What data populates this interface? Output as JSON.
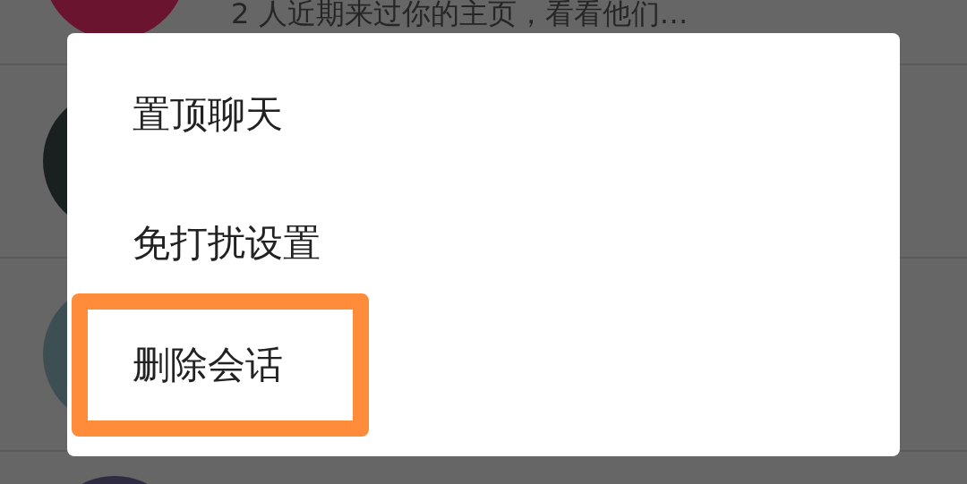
{
  "chat_list": {
    "rows": [
      {
        "kind": "picture",
        "color": "#6a1430",
        "preview": "2 人近期来过你的主页，看看他们…"
      },
      {
        "kind": "picture",
        "color": "#1a1f20"
      },
      {
        "kind": "picture",
        "color": "#3d4f52"
      },
      {
        "kind": "picture",
        "color": "#2f2b40"
      }
    ]
  },
  "menu": {
    "items": [
      {
        "label": "置顶聊天",
        "highlighted": false
      },
      {
        "label": "免打扰设置",
        "highlighted": false
      },
      {
        "label": "删除会话",
        "highlighted": true
      }
    ]
  }
}
